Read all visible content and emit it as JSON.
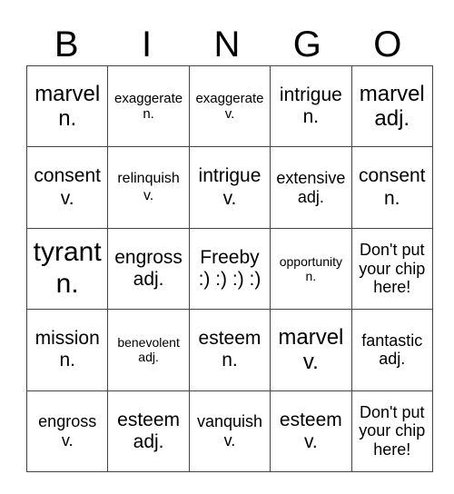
{
  "header": [
    "B",
    "I",
    "N",
    "G",
    "O"
  ],
  "rows": [
    [
      {
        "word": "marvel",
        "pos": "n."
      },
      {
        "word": "exaggerate",
        "pos": "n."
      },
      {
        "word": "exaggerate",
        "pos": "v."
      },
      {
        "word": "intrigue",
        "pos": "n."
      },
      {
        "word": "marvel",
        "pos": "adj."
      }
    ],
    [
      {
        "word": "consent",
        "pos": "v."
      },
      {
        "word": "relinquish",
        "pos": "v."
      },
      {
        "word": "intrigue",
        "pos": "v."
      },
      {
        "word": "extensive",
        "pos": "adj."
      },
      {
        "word": "consent",
        "pos": "n."
      }
    ],
    [
      {
        "word": "tyrant",
        "pos": "n."
      },
      {
        "word": "engross",
        "pos": "adj."
      },
      {
        "word": "Freeby",
        "pos": ":) :) :) :)"
      },
      {
        "word": "opportunity",
        "pos": "n."
      },
      {
        "word": "Don't put your chip here!",
        "pos": ""
      }
    ],
    [
      {
        "word": "mission",
        "pos": "n."
      },
      {
        "word": "benevolent",
        "pos": "adj."
      },
      {
        "word": "esteem",
        "pos": "n."
      },
      {
        "word": "marvel",
        "pos": "v."
      },
      {
        "word": "fantastic",
        "pos": "adj."
      }
    ],
    [
      {
        "word": "engross",
        "pos": "v."
      },
      {
        "word": "esteem",
        "pos": "adj."
      },
      {
        "word": "vanquish",
        "pos": "v."
      },
      {
        "word": "esteem",
        "pos": "v."
      },
      {
        "word": "Don't put your chip here!",
        "pos": ""
      }
    ]
  ]
}
